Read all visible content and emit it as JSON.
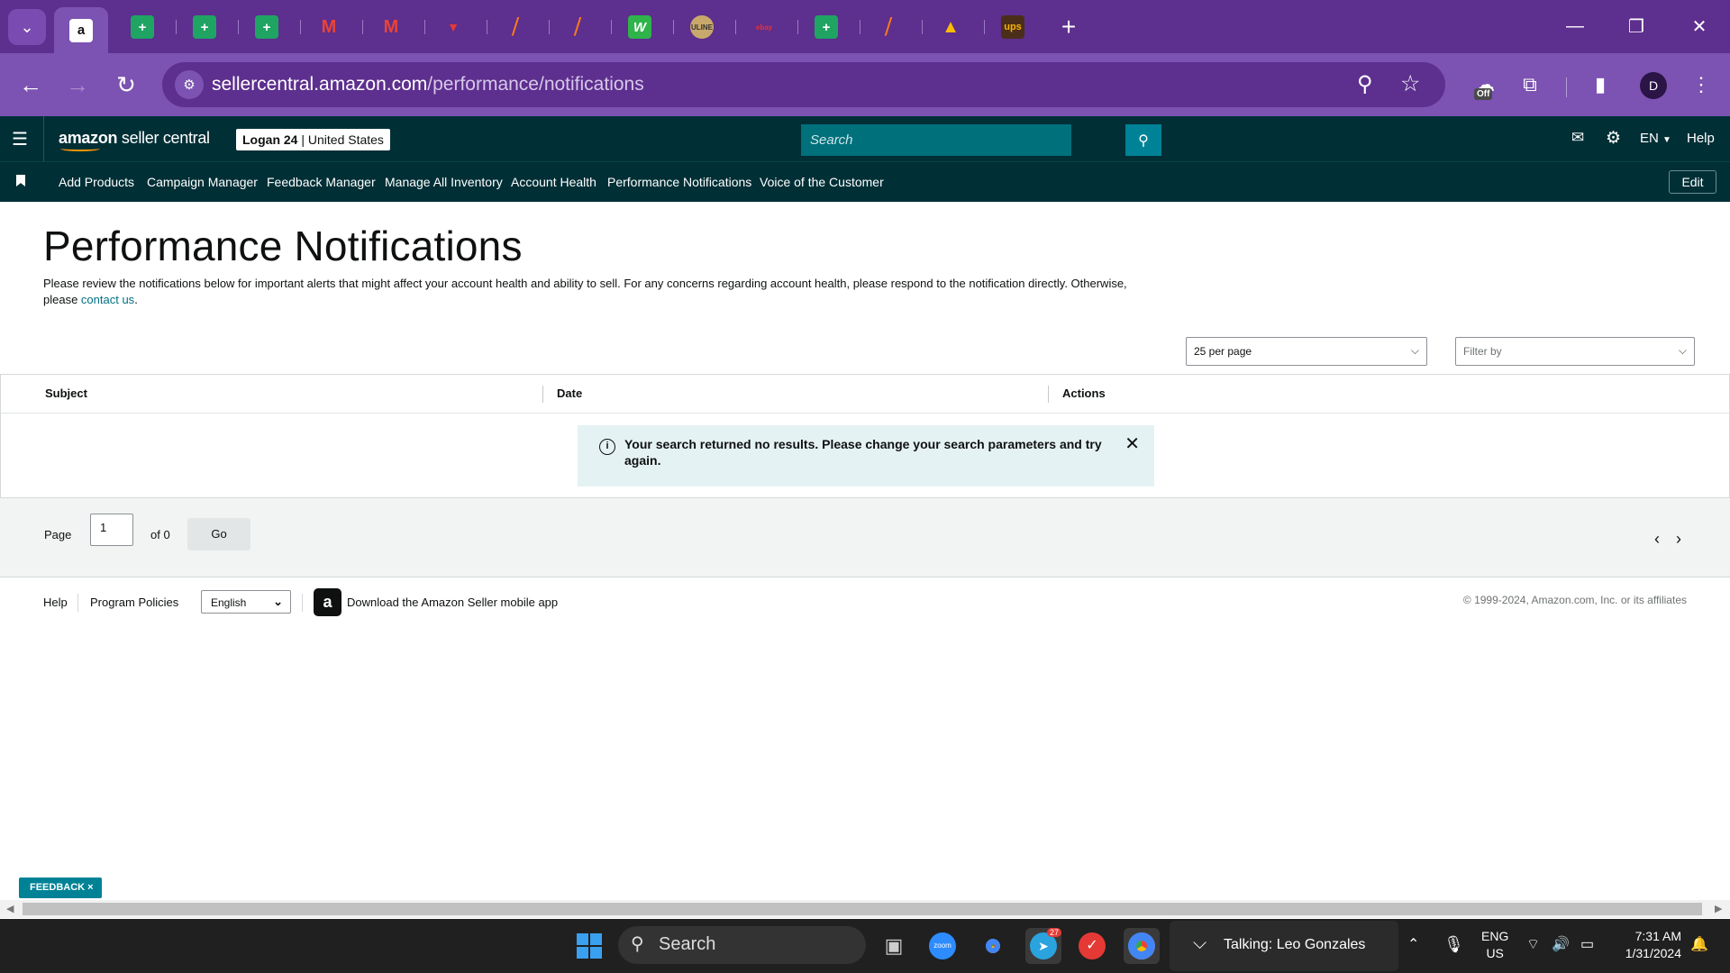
{
  "browser": {
    "url_host": "sellercentral.amazon.com",
    "url_path": "/performance/notifications",
    "profile_initial": "D",
    "extension_badge": "Off",
    "tab_icons": [
      "amazon-icon",
      "sheets-icon",
      "sheets-icon",
      "sheets-icon",
      "gmail-icon",
      "gmail-icon",
      "brand-icon",
      "stack-icon",
      "stack-icon",
      "w-icon",
      "uline-icon",
      "ebay-icon",
      "sheets-icon",
      "stack-icon",
      "drive-icon",
      "ups-icon"
    ]
  },
  "header": {
    "logo_amazon": "amazon",
    "logo_rest": " seller central",
    "account_name": "Logan 24",
    "account_region": "| United States",
    "search_placeholder": "Search",
    "lang": "EN",
    "help": "Help"
  },
  "nav": {
    "items": [
      "Add Products",
      "Campaign Manager",
      "Feedback Manager",
      "Manage All Inventory",
      "Account Health",
      "Performance Notifications",
      "Voice of the Customer"
    ],
    "edit_label": "Edit"
  },
  "page": {
    "title": "Performance Notifications",
    "description": "Please review the notifications below for important alerts that might affect your account health and ability to sell. For any concerns regarding account health, please respond to the notification directly. Otherwise, please ",
    "contact_link": "contact us",
    "per_page": "25 per page",
    "filter_placeholder": "Filter by"
  },
  "table": {
    "columns": [
      "Subject",
      "Date",
      "Actions"
    ],
    "alert": "Your search returned no results. Please change your search parameters and try again."
  },
  "pager": {
    "page_label": "Page",
    "page_value": "1",
    "of_label": "of 0",
    "go_label": "Go"
  },
  "footer": {
    "help": "Help",
    "policies": "Program Policies",
    "language": "English",
    "app_text": "Download the Amazon Seller mobile app",
    "copyright": "© 1999-2024, Amazon.com, Inc. or its affiliates"
  },
  "feedback_label": "FEEDBACK ×",
  "taskbar": {
    "search_label": "Search",
    "talking": "Talking: Leo Gonzales",
    "lang_top": "ENG",
    "lang_bottom": "US",
    "time": "7:31 AM",
    "date": "1/31/2024",
    "telegram_badge": "27"
  },
  "colors": {
    "browser_frame": "#5d2f8e",
    "seller_header": "#002f36",
    "link": "#007185",
    "alert_bg": "#e5f2f3"
  }
}
